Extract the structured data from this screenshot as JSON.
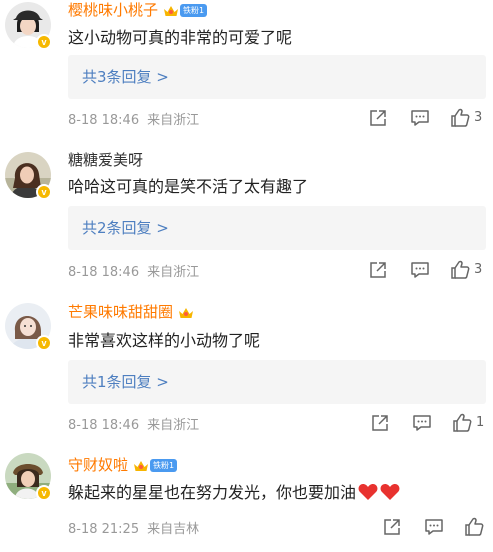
{
  "comments": [
    {
      "username": "樱桃味小桃子",
      "user_style": "vip",
      "fan_badge": "铁粉1",
      "content": "这小动物可真的非常的可爱了呢",
      "replies_label": "共3条回复 >",
      "date": "8-18 18:46",
      "location": "来自浙江",
      "likes": "3"
    },
    {
      "username": "糖糖爱美呀",
      "user_style": "normal",
      "content": "哈哈这可真的是笑不活了太有趣了",
      "replies_label": "共2条回复 >",
      "date": "8-18 18:46",
      "location": "来自浙江",
      "likes": "3"
    },
    {
      "username": "芒果味味甜甜圈",
      "user_style": "vip",
      "content": "非常喜欢这样的小动物了呢",
      "replies_label": "共1条回复 >",
      "date": "8-18 18:46",
      "location": "来自浙江",
      "likes": "1"
    },
    {
      "username": "守财奴啦",
      "user_style": "vip",
      "fan_badge": "铁粉1",
      "content": "躲起来的星星也在努力发光，你也要加油",
      "date": "8-18 21:25",
      "location": "来自吉林"
    }
  ],
  "colors": {
    "vip_name": "#ff7a00",
    "reply_link": "#4e7fc0",
    "fan_badge": "#4a9af0",
    "verified_badge": "#f6b800",
    "heart": "#e8322f"
  },
  "icons": [
    "share-icon",
    "comment-icon",
    "like-icon",
    "crown-icon",
    "heart-icon"
  ]
}
